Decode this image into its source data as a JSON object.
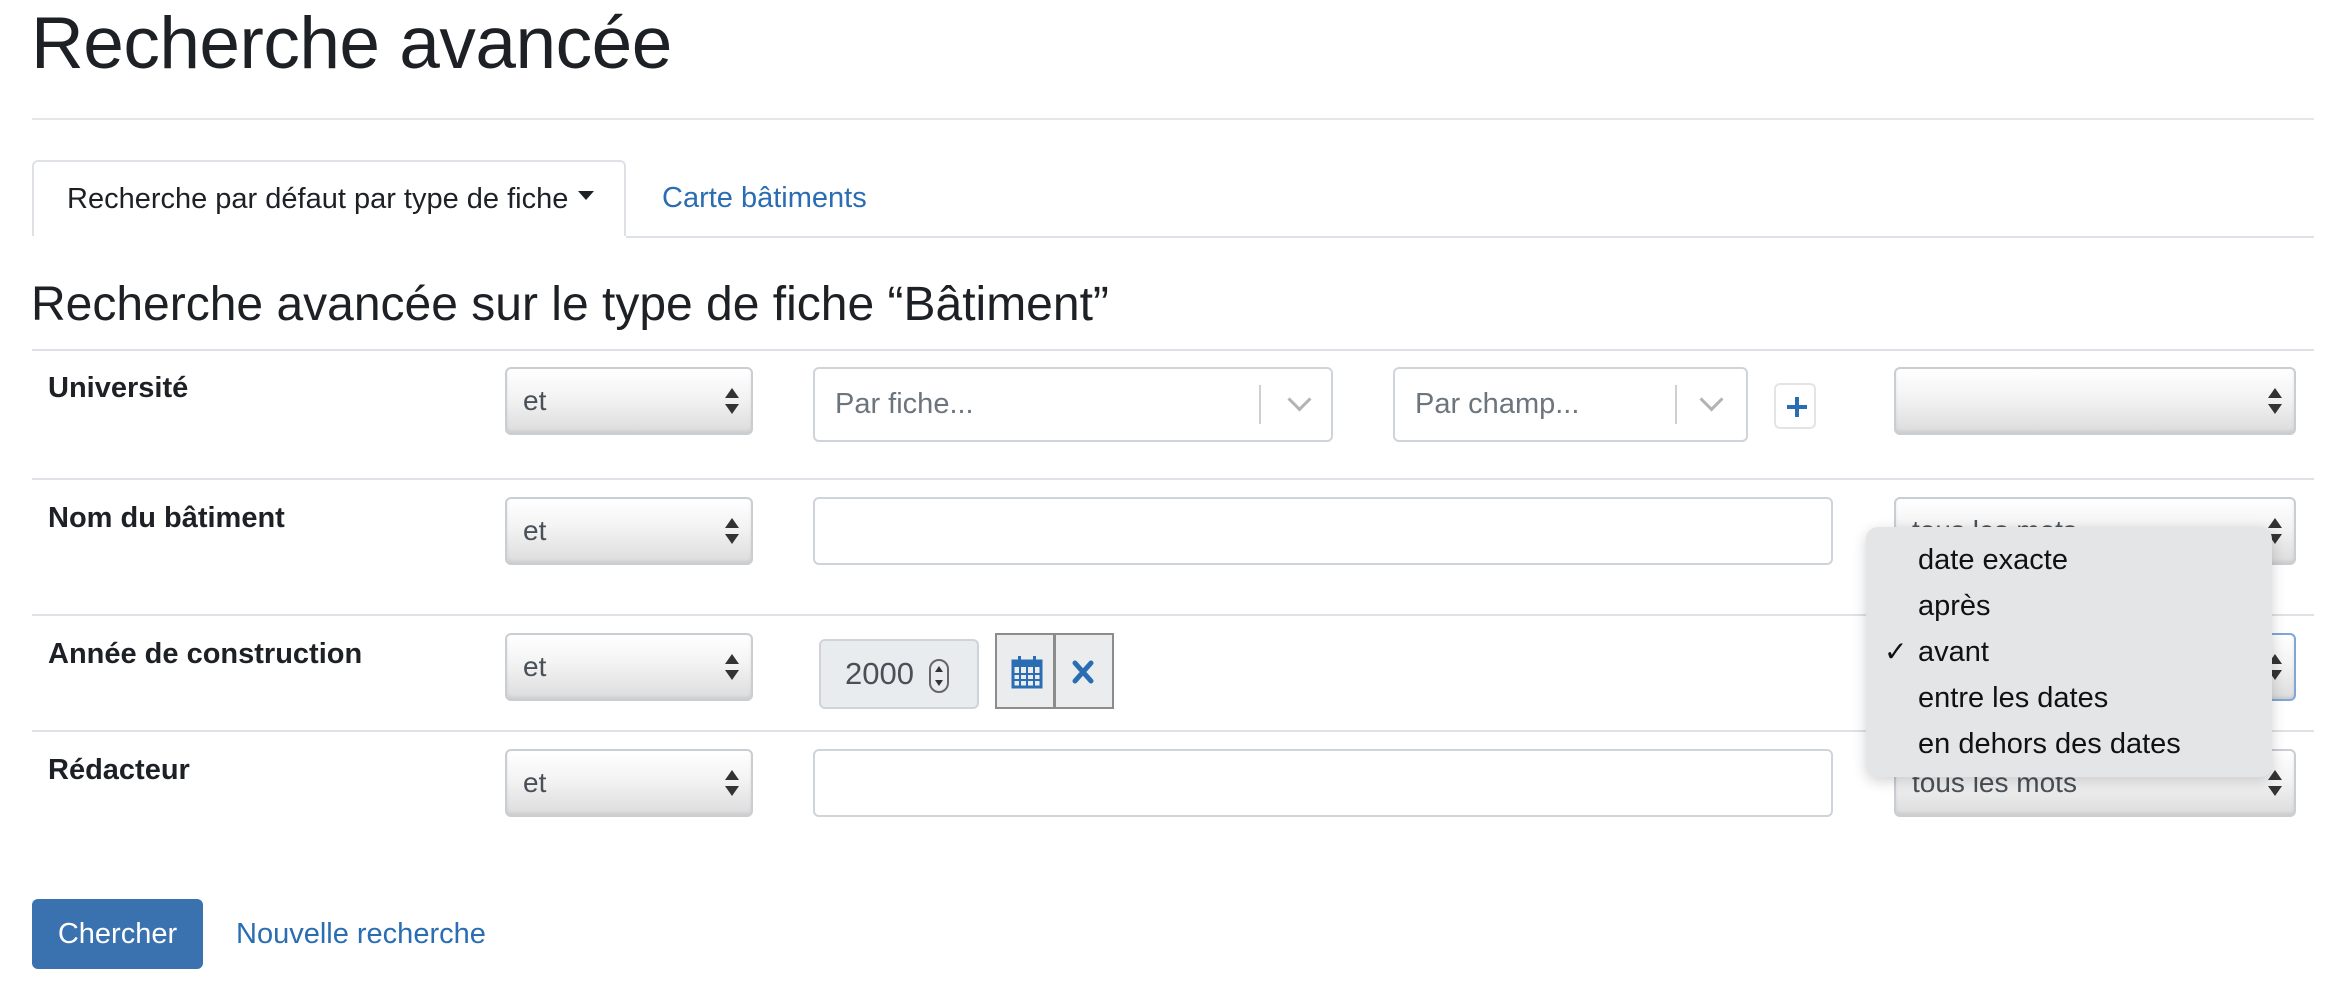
{
  "page": {
    "title": "Recherche avancée"
  },
  "tabs": [
    {
      "label": "Recherche par défaut par type de fiche",
      "active": true
    },
    {
      "label": "Carte bâtiments",
      "active": false
    }
  ],
  "section_title": "Recherche avancée sur le type de fiche “Bâtiment”",
  "rows": [
    {
      "label": "Université",
      "operator": "et",
      "fiche_placeholder": "Par fiche...",
      "champ_placeholder": "Par champ...",
      "mode": ""
    },
    {
      "label": "Nom du bâtiment",
      "operator": "et",
      "value": "",
      "mode": "tous les mots"
    },
    {
      "label": "Année de construction",
      "operator": "et",
      "year": "2000",
      "mode": "avant"
    },
    {
      "label": "Rédacteur",
      "operator": "et",
      "value": "",
      "mode": "tous les mots"
    }
  ],
  "date_mode_dropdown": {
    "options": [
      "date exacte",
      "après",
      "avant",
      "entre les dates",
      "en dehors des dates"
    ],
    "selected": "avant",
    "check_glyph": "✓"
  },
  "actions": {
    "search_label": "Chercher",
    "new_search_label": "Nouvelle recherche"
  },
  "colors": {
    "link": "#2a6db3",
    "primary_button": "#3a72b0",
    "border": "#dee2e6"
  },
  "icons": {
    "add": "plus-icon",
    "calendar": "calendar-icon",
    "clear": "close-icon",
    "updown": "select-arrows-icon",
    "dropdown": "chevron-down-icon"
  }
}
